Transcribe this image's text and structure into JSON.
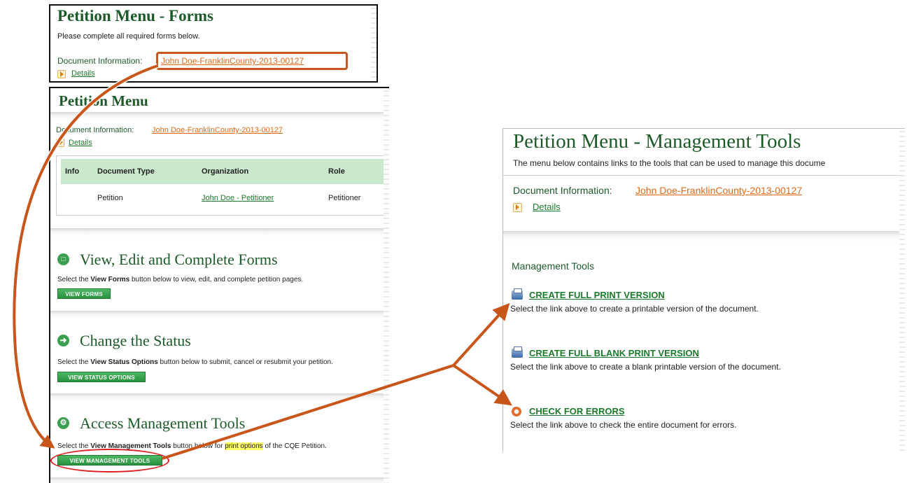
{
  "panel1": {
    "title": "Petition Menu - Forms",
    "subtitle": "Please complete all required forms below.",
    "doc_label": "Document Information:",
    "doc_link": "John Doe-FranklinCounty-2013-00127",
    "details": "Details"
  },
  "panel2": {
    "title": "Petition Menu",
    "doc_label": "Document Information:",
    "doc_link": "John Doe-FranklinCounty-2013-00127",
    "details": "Details",
    "table": {
      "headers": [
        "Info",
        "Document Type",
        "Organization",
        "Role"
      ],
      "row": {
        "info": "",
        "type": "Petition",
        "org": "John Doe - Petitioner",
        "role": "Petitioner"
      }
    },
    "section1": {
      "title": "View, Edit and Complete Forms",
      "desc_pre": "Select the ",
      "desc_bold": "View Forms",
      "desc_post": " button below to view, edit, and complete petition pages.",
      "button": "VIEW FORMS"
    },
    "section2": {
      "title": "Change the Status",
      "desc_pre": "Select the ",
      "desc_bold": "View Status Options",
      "desc_post": " button below to submit, cancel or resubmit your petition.",
      "button": "VIEW STATUS OPTIONS"
    },
    "section3": {
      "title": "Access Management Tools",
      "desc_pre": "Select the ",
      "desc_bold": "View Management Tools",
      "desc_mid": " button below for ",
      "desc_highlight": "print options",
      "desc_post": " of the CQE Petition.",
      "button": "VIEW MANAGEMENT TOOLS"
    }
  },
  "panel3": {
    "title": "Petition Menu - Management Tools",
    "subtitle": "The menu below contains links to the tools that can be used to manage this docume",
    "doc_label": "Document Information:",
    "doc_link": "John Doe-FranklinCounty-2013-00127",
    "details": "Details",
    "section_label": "Management Tools",
    "tools": [
      {
        "label": "CREATE FULL PRINT VERSION",
        "desc": "Select the link above to create a printable version of the document.",
        "icon": "printer-icon"
      },
      {
        "label": "CREATE FULL BLANK PRINT VERSION",
        "desc": "Select the link above to create a blank printable version of the document.",
        "icon": "printer-icon"
      },
      {
        "label": "CHECK FOR ERRORS",
        "desc": "Select the link above to check the entire document for errors.",
        "icon": "error-check-icon"
      }
    ]
  },
  "colors": {
    "title_green": "#1d5a2a",
    "link_green": "#1b7a2a",
    "link_orange": "#e26a1a",
    "button_green": "#28913f",
    "arrow_orange": "#c8561a",
    "highlight_yellow": "#ffff66",
    "table_header": "#c9e8cc"
  }
}
